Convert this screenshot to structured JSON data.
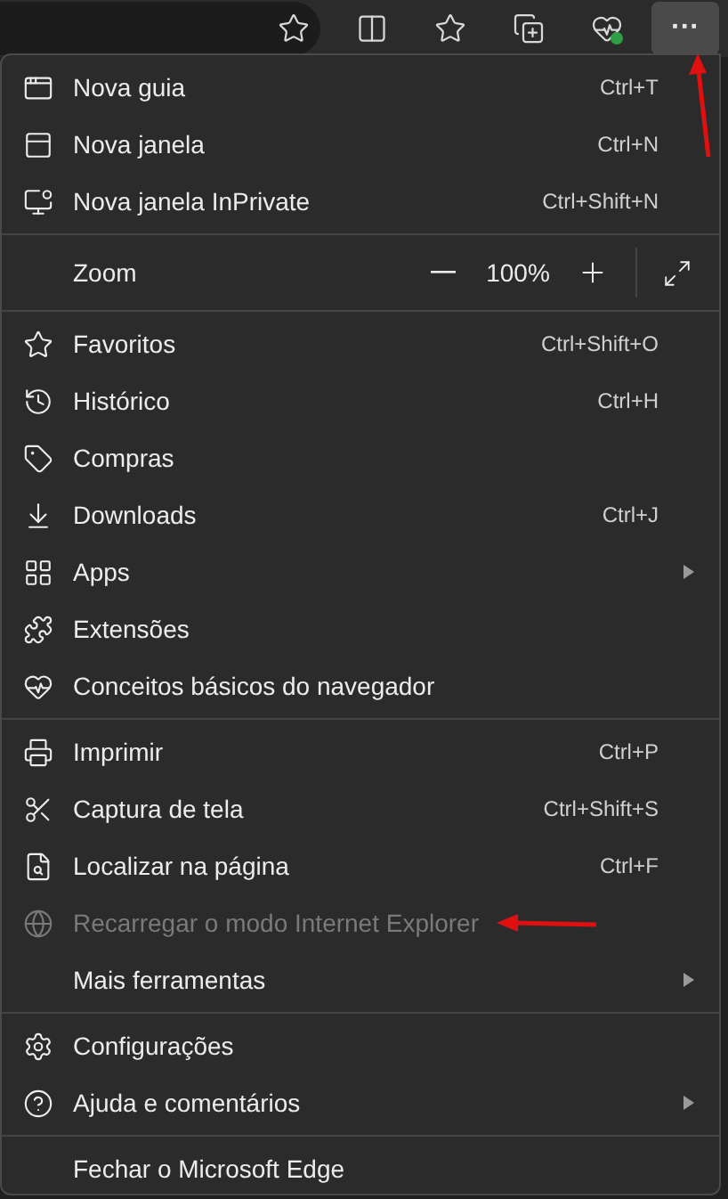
{
  "toolbar": {
    "buttons": [
      {
        "kind": "star",
        "selected": false
      },
      {
        "kind": "split",
        "selected": false
      },
      {
        "kind": "favorites",
        "selected": false
      },
      {
        "kind": "collections",
        "selected": false
      },
      {
        "kind": "health",
        "selected": false
      },
      {
        "kind": "more",
        "selected": true,
        "label": "···"
      }
    ]
  },
  "menu": {
    "sections": [
      [
        {
          "kind": "item",
          "label": "Nova guia",
          "shortcut": "Ctrl+T",
          "disabled": false,
          "submenu": false
        },
        {
          "kind": "item",
          "label": "Nova janela",
          "shortcut": "Ctrl+N",
          "disabled": false,
          "submenu": false
        },
        {
          "kind": "item",
          "label": "Nova janela InPrivate",
          "shortcut": "Ctrl+Shift+N",
          "disabled": false,
          "submenu": false
        }
      ],
      [
        {
          "kind": "zoom",
          "label": "Zoom",
          "value": "100%"
        }
      ],
      [
        {
          "kind": "item",
          "label": "Favoritos",
          "shortcut": "Ctrl+Shift+O",
          "disabled": false,
          "submenu": false
        },
        {
          "kind": "item",
          "label": "Histórico",
          "shortcut": "Ctrl+H",
          "disabled": false,
          "submenu": false
        },
        {
          "kind": "item",
          "label": "Compras",
          "disabled": false,
          "submenu": false
        },
        {
          "kind": "item",
          "label": "Downloads",
          "shortcut": "Ctrl+J",
          "disabled": false,
          "submenu": false
        },
        {
          "kind": "item",
          "label": "Apps",
          "disabled": false,
          "submenu": true
        },
        {
          "kind": "item",
          "label": "Extensões",
          "disabled": false,
          "submenu": false
        },
        {
          "kind": "item",
          "label": "Conceitos básicos do navegador",
          "disabled": false,
          "submenu": false
        }
      ],
      [
        {
          "kind": "item",
          "label": "Imprimir",
          "shortcut": "Ctrl+P",
          "disabled": false,
          "submenu": false
        },
        {
          "kind": "item",
          "label": "Captura de tela",
          "shortcut": "Ctrl+Shift+S",
          "disabled": false,
          "submenu": false
        },
        {
          "kind": "item",
          "label": "Localizar na página",
          "shortcut": "Ctrl+F",
          "disabled": false,
          "submenu": false
        },
        {
          "kind": "item",
          "label": "Recarregar o modo Internet Explorer",
          "disabled": true,
          "submenu": false
        },
        {
          "kind": "item",
          "label": "Mais ferramentas",
          "disabled": false,
          "submenu": true
        }
      ],
      [
        {
          "kind": "item",
          "label": "Configurações",
          "disabled": false,
          "submenu": false
        },
        {
          "kind": "item",
          "label": "Ajuda e comentários",
          "disabled": false,
          "submenu": true
        }
      ],
      [
        {
          "kind": "item",
          "label": "Fechar o Microsoft Edge",
          "disabled": false,
          "submenu": false
        }
      ]
    ]
  }
}
